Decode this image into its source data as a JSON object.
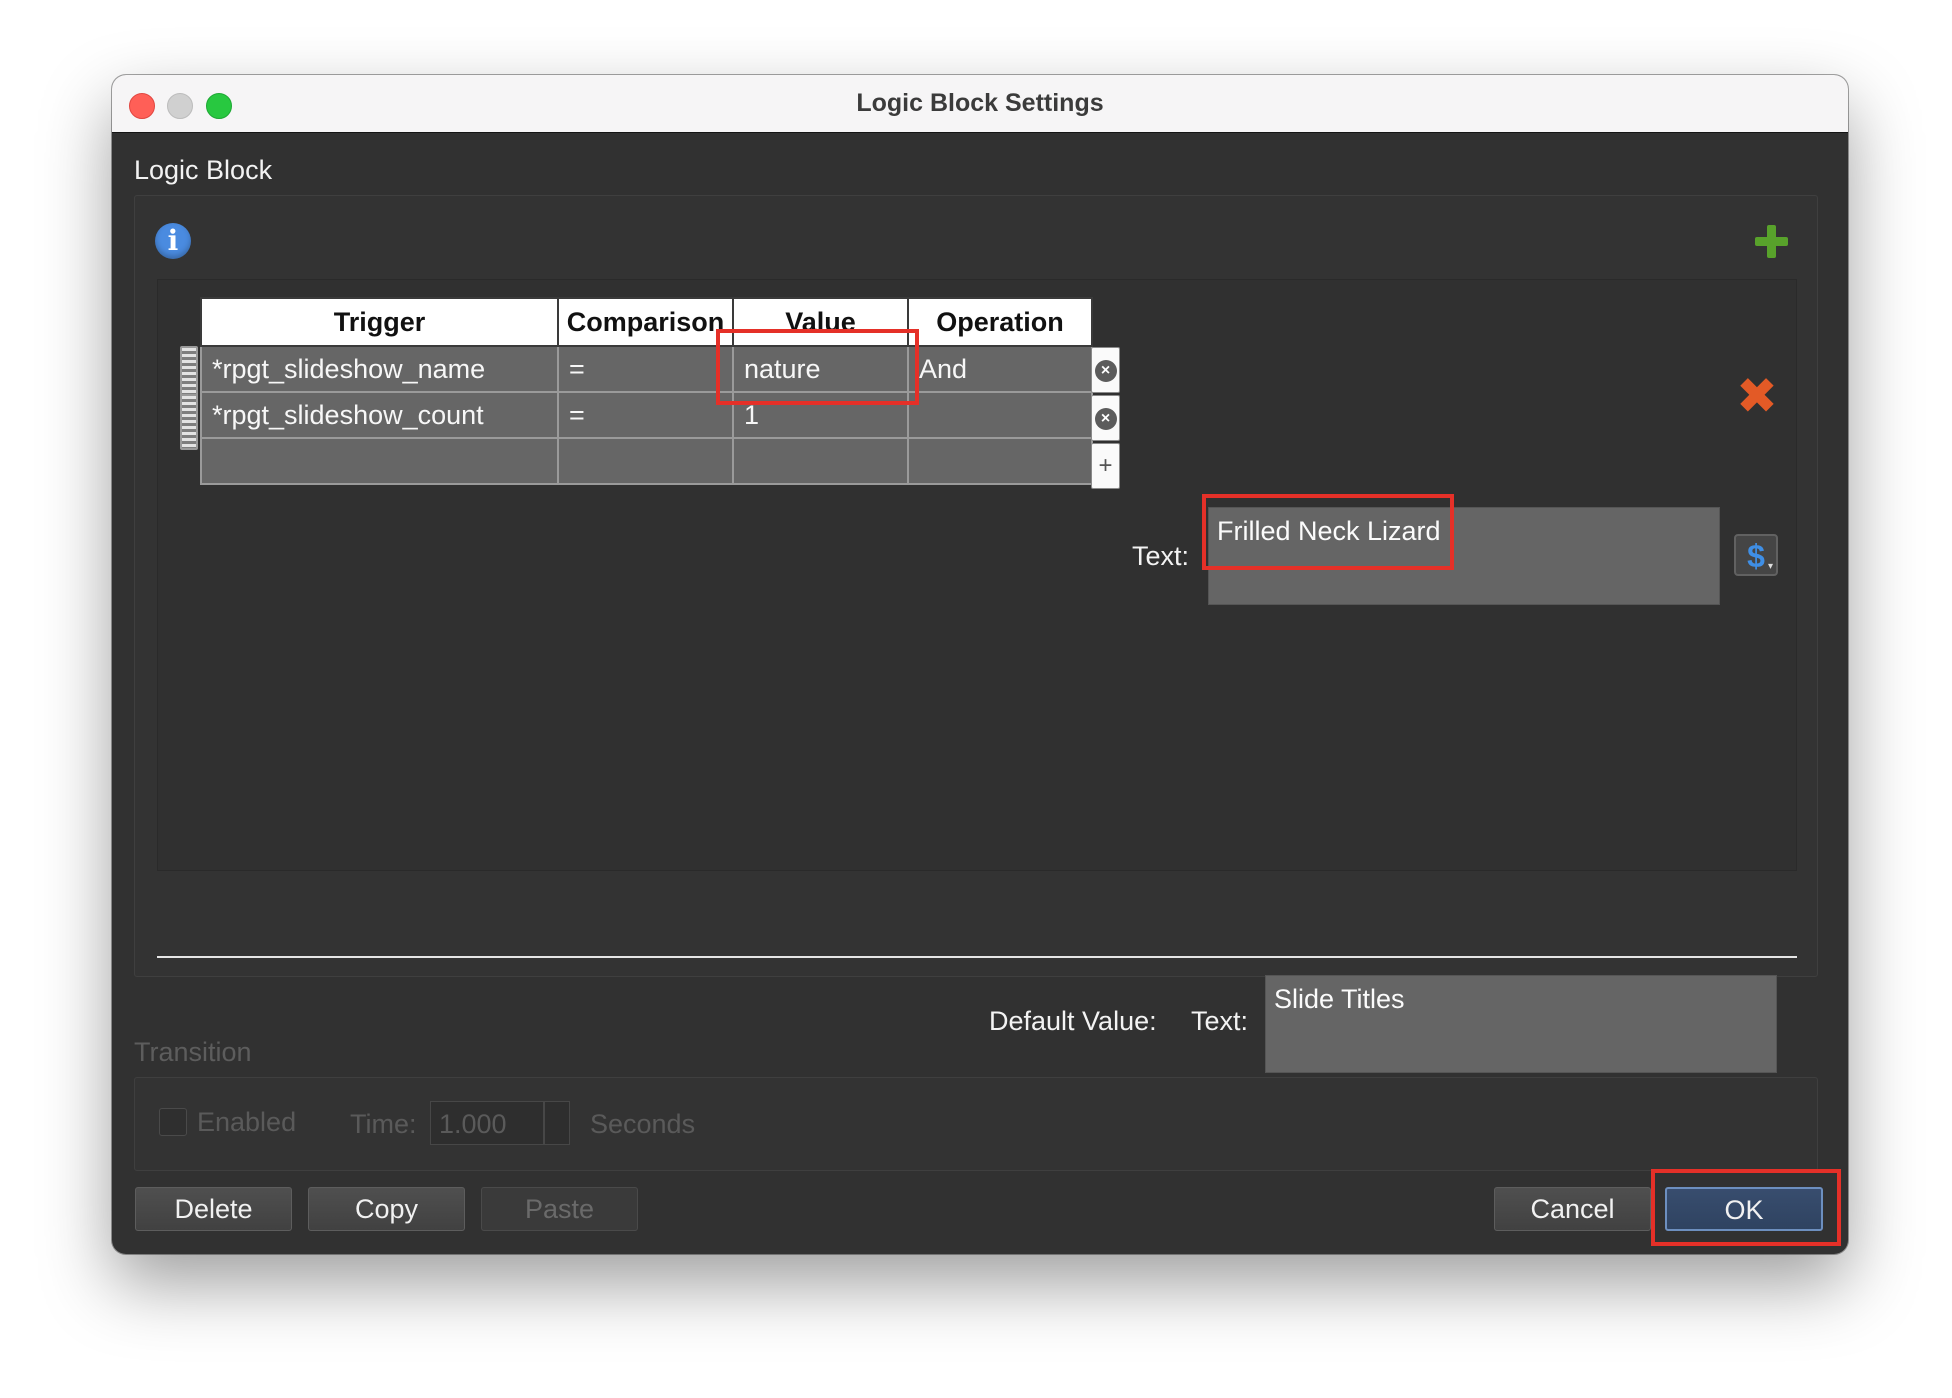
{
  "window": {
    "title": "Logic Block Settings"
  },
  "logic_block": {
    "section_label": "Logic Block",
    "columns": [
      "Trigger",
      "Comparison",
      "Value",
      "Operation"
    ],
    "rows": [
      {
        "trigger": "*rpgt_slideshow_name",
        "comparison": "=",
        "value": "nature",
        "operation": "And"
      },
      {
        "trigger": "*rpgt_slideshow_count",
        "comparison": "=",
        "value": "1",
        "operation": ""
      }
    ],
    "text_label": "Text:",
    "text_value": "Frilled Neck Lizard",
    "default_value_label": "Default Value:",
    "default_text_label": "Text:",
    "default_text_value": "Slide Titles",
    "icons": {
      "info": "info-icon",
      "add_block": "green-plus-icon",
      "delete_block": "orange-x-icon",
      "row_delete": "circle-x-icon",
      "row_add": "plus-icon",
      "variable": "dollar-icon",
      "drag": "drag-handle-icon"
    },
    "symbols": {
      "info": "i",
      "row_delete": "×",
      "row_add": "+",
      "delete_block": "✖",
      "variable": "$",
      "dropdown": "▾"
    }
  },
  "transition": {
    "section_label": "Transition",
    "enabled_label": "Enabled",
    "time_label": "Time:",
    "time_value": "1.000",
    "seconds_label": "Seconds"
  },
  "buttons": {
    "delete": "Delete",
    "copy": "Copy",
    "paste": "Paste",
    "cancel": "Cancel",
    "ok": "OK"
  },
  "colors": {
    "highlight": "#e53028",
    "accent_plus": "#58a22b",
    "accent_delete": "#e35a26",
    "info": "#4a8be0"
  }
}
